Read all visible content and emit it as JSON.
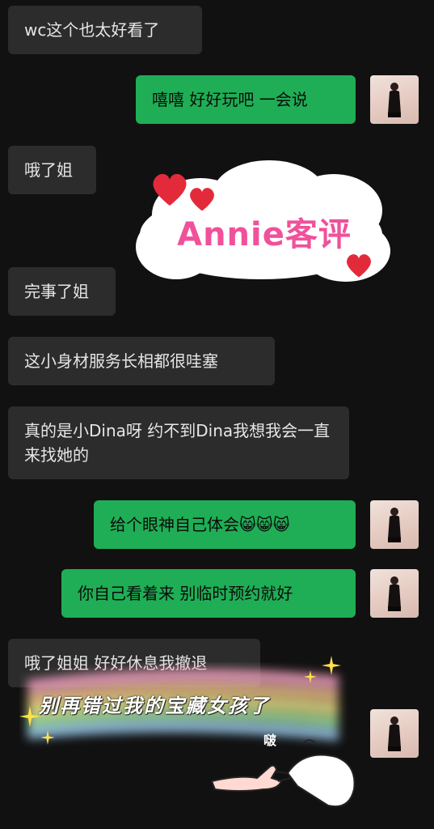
{
  "messages": [
    {
      "side": "in",
      "text": "wc这个也太好看了"
    },
    {
      "side": "out",
      "text": "嘻嘻 好好玩吧 一会说"
    },
    {
      "side": "in",
      "text": "哦了姐"
    },
    {
      "side": "in",
      "text": "完事了姐"
    },
    {
      "side": "in",
      "text": "这小身材服务长相都很哇塞"
    },
    {
      "side": "in",
      "text": "真的是小Dina呀 约不到Dina我想我会一直来找她的"
    },
    {
      "side": "out",
      "text": "给个眼神自己体会😸😸😸"
    },
    {
      "side": "out",
      "text": "你自己看着来 别临时预约就好"
    },
    {
      "side": "in",
      "text": "哦了姐姐 好好休息我撤退"
    }
  ],
  "overlays": {
    "cloud_label": "Annie客评",
    "rainbow_label": "别再错过我的宝藏女孩了",
    "hand_sticker_text": "啵"
  },
  "colors": {
    "background": "#111111",
    "incoming_bubble": "#2c2c2c",
    "outgoing_bubble": "#1fae55",
    "label_pink": "#f0519a"
  },
  "icons": {
    "avatar": "contact-avatar-icon",
    "hearts": "heart-icon",
    "sparkle": "sparkle-icon"
  }
}
